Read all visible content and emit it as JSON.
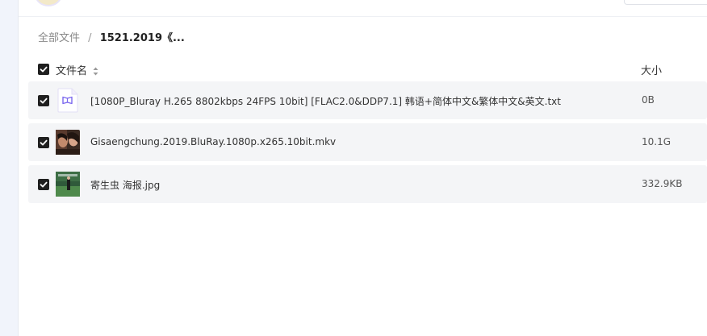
{
  "header": {
    "cut_text": "…",
    "cut_link": "…"
  },
  "breadcrumb": {
    "root": "全部文件",
    "separator": "/",
    "current": "1521.2019《..."
  },
  "table": {
    "columns": {
      "name": "文件名",
      "size": "大小"
    },
    "rows": [
      {
        "name": "[1080P_Bluray H.265 8802kbps 24FPS 10bit] [FLAC2.0&DDP7.1] 韩语+简体中文&繁体中文&英文.txt",
        "size": "0B",
        "icon": "text-file-icon",
        "checked": true
      },
      {
        "name": "Gisaengchung.2019.BluRay.1080p.x265.10bit.mkv",
        "size": "10.1G",
        "icon": "video-thumbnail",
        "checked": true
      },
      {
        "name": "寄生虫 海报.jpg",
        "size": "332.9KB",
        "icon": "image-thumbnail",
        "checked": true
      }
    ]
  },
  "colors": {
    "checkbox": "#1f1f1f",
    "row_bg": "#f4f5f7",
    "accent": "#7b68ee"
  }
}
